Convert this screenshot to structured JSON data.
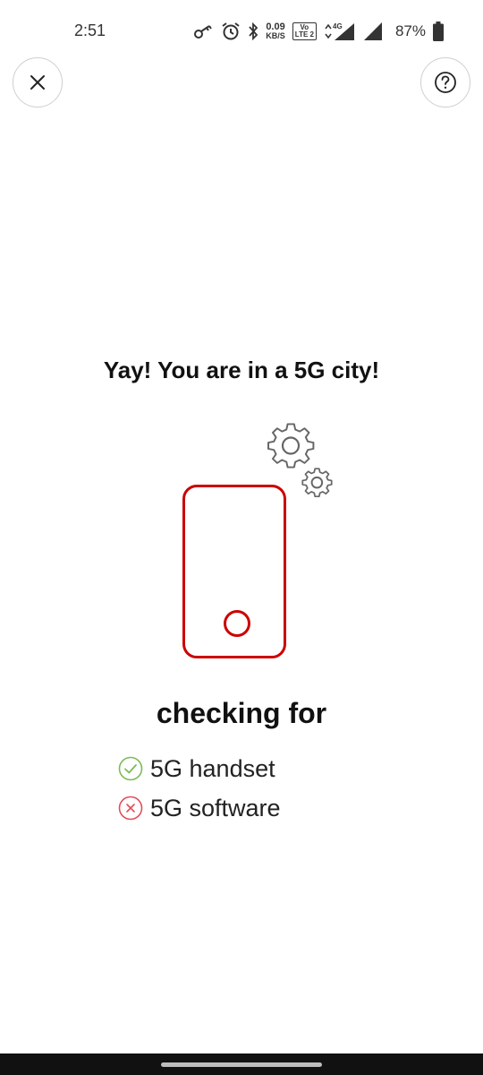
{
  "status_bar": {
    "time": "2:51",
    "net_speed_value": "0.09",
    "net_speed_unit": "KB/S",
    "volte_top": "Vo",
    "volte_bottom": "LTE 2",
    "network_type": "4G",
    "battery_percent": "87%"
  },
  "header": {
    "close_icon": "close-icon",
    "help_icon": "help-icon"
  },
  "main": {
    "headline": "Yay! You are in a 5G city!",
    "checking_title": "checking for",
    "checks": [
      {
        "label": "5G handset",
        "status": "pass",
        "icon": "check-circle-icon",
        "color": "#7cbb55"
      },
      {
        "label": "5G software",
        "status": "fail",
        "icon": "x-circle-icon",
        "color": "#e0505a"
      }
    ],
    "accent_color": "#cc0000"
  }
}
